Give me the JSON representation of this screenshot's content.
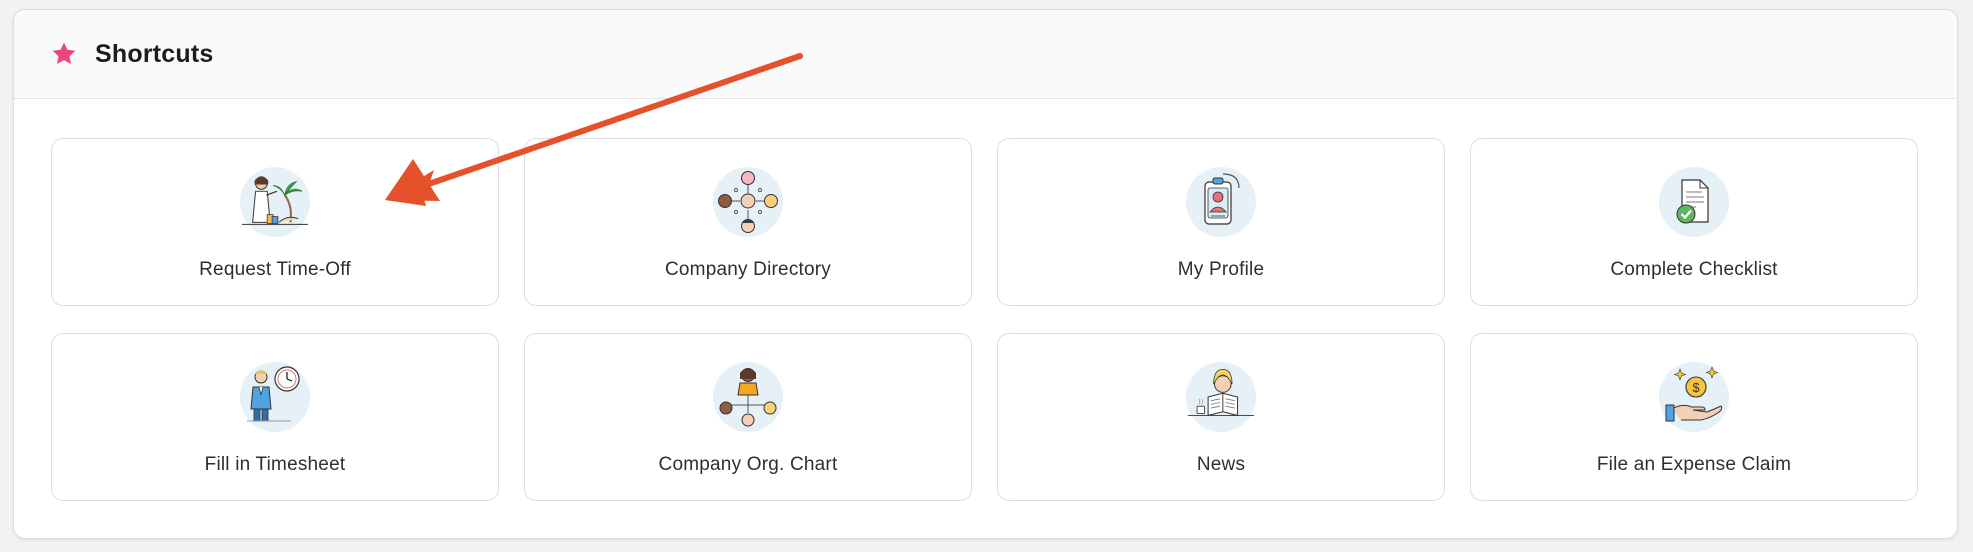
{
  "panel": {
    "title": "Shortcuts",
    "title_icon": "star-icon",
    "accent_color": "#e8467c"
  },
  "shortcuts": [
    {
      "label": "Request Time-Off",
      "icon": "vacation-icon"
    },
    {
      "label": "Company Directory",
      "icon": "directory-icon"
    },
    {
      "label": "My Profile",
      "icon": "id-badge-icon"
    },
    {
      "label": "Complete Checklist",
      "icon": "checklist-icon"
    },
    {
      "label": "Fill in Timesheet",
      "icon": "timesheet-icon"
    },
    {
      "label": "Company Org. Chart",
      "icon": "org-chart-icon"
    },
    {
      "label": "News",
      "icon": "news-icon"
    },
    {
      "label": "File an Expense Claim",
      "icon": "expense-icon"
    }
  ],
  "annotation": {
    "arrow_color": "#e4512b"
  }
}
